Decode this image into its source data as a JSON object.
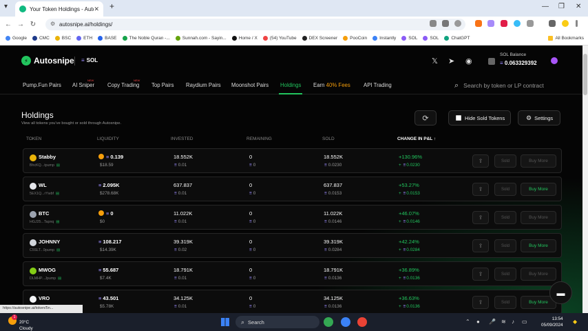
{
  "browser": {
    "tab_title": "Your Token Holdings - Autosnip",
    "url": "autosnipe.ai/holdings/",
    "bookmarks": [
      "Google",
      "CMC",
      "BSC",
      "ETH",
      "BASE",
      "The Noble Quran -...",
      "Sunnah.com - Sayin...",
      "Home / X",
      "(54) YouTube",
      "DEX Screener",
      "PooCoin",
      "Instantly",
      "SOL",
      "SOL",
      "ChatGPT"
    ],
    "all_bookmarks": "All Bookmarks",
    "status_url": "https://autosnipe.ai/token/5n..."
  },
  "header": {
    "logo": "Autosnipe",
    "chain": "SOL",
    "balance_label": "SOL Balance",
    "balance_value": "0.063329392"
  },
  "nav": {
    "items": [
      "Pump.Fun Pairs",
      "AI Sniper",
      "Copy Trading",
      "Top Pairs",
      "Raydium Pairs",
      "Moonshot Pairs",
      "Holdings",
      "Earn",
      "API Trading"
    ],
    "earn_highlight": "40% Fees",
    "new_badge": "NEW",
    "search_placeholder": "Search by token or LP contract"
  },
  "page": {
    "title": "Holdings",
    "subtitle": "View all tokens you've bought or sold through Autosnipe.",
    "hide_sold": "Hide Sold Tokens",
    "settings": "Settings"
  },
  "table": {
    "headers": [
      "TOKEN",
      "LIQUIDITY",
      "INVESTED",
      "REMAINING",
      "SOLD",
      "CHANGE IN P&L ↑"
    ],
    "sold_label": "Sold",
    "buy_label": "Buy More",
    "rows": [
      {
        "name": "Stabby",
        "addr": "BhcKQ...tpump",
        "liq": "0.139",
        "liq_usd": "$18.59",
        "invested": "18.552K",
        "invested_sol": "0.01",
        "remaining": "0",
        "remaining_sol": "0",
        "sold": "18.552K",
        "sold_sol": "0.0230",
        "pnl": "+130.96%",
        "pnl_sol": "0.0230",
        "icon_color": "#eab308",
        "buy_enabled": false
      },
      {
        "name": "WL",
        "addr": "5EX1Q...rYwbf",
        "liq": "2.095K",
        "liq_usd": "$278.68K",
        "invested": "637.837",
        "invested_sol": "0.01",
        "remaining": "0",
        "remaining_sol": "0",
        "sold": "637.837",
        "sold_sol": "0.0153",
        "pnl": "+53.27%",
        "pnl_sol": "0.0153",
        "icon_color": "#e5e7eb",
        "buy_enabled": true
      },
      {
        "name": "BTC",
        "addr": "HGJ25...Tapnq",
        "liq": "0",
        "liq_usd": "$0",
        "invested": "11.022K",
        "invested_sol": "0.01",
        "remaining": "0",
        "remaining_sol": "0",
        "sold": "11.022K",
        "sold_sol": "0.0146",
        "pnl": "+46.07%",
        "pnl_sol": "0.0146",
        "icon_color": "#9ca3af",
        "buy_enabled": false
      },
      {
        "name": "JOHNNY",
        "addr": "C5SLT...9pump",
        "liq": "108.217",
        "liq_usd": "$14.39K",
        "invested": "39.319K",
        "invested_sol": "0.02",
        "remaining": "0",
        "remaining_sol": "0",
        "sold": "39.319K",
        "sold_sol": "0.0284",
        "pnl": "+42.24%",
        "pnl_sol": "0.0284",
        "icon_color": "#d1d5db",
        "buy_enabled": true
      },
      {
        "name": "MWOG",
        "addr": "DLMHP...Jpump",
        "liq": "55.687",
        "liq_usd": "$7.4K",
        "invested": "18.791K",
        "invested_sol": "0.01",
        "remaining": "0",
        "remaining_sol": "0",
        "sold": "18.791K",
        "sold_sol": "0.0136",
        "pnl": "+36.89%",
        "pnl_sol": "0.0136",
        "icon_color": "#84cc16",
        "buy_enabled": false
      },
      {
        "name": "VRO",
        "addr": "9wHxa...tpump",
        "liq": "43.501",
        "liq_usd": "$5.78K",
        "invested": "34.125K",
        "invested_sol": "0.01",
        "remaining": "0",
        "remaining_sol": "0",
        "sold": "34.125K",
        "sold_sol": "0.0136",
        "pnl": "+36.63%",
        "pnl_sol": "0.0136",
        "icon_color": "#f3f4f6",
        "buy_enabled": true
      }
    ]
  },
  "taskbar": {
    "temp": "20°C",
    "weather": "Cloudy",
    "search": "Search",
    "time": "13:54",
    "date": "05/09/2024",
    "notif_count": "1"
  },
  "colors": {
    "accent": "#22c55e",
    "sol": "#9b8cff",
    "bg": "#050505"
  }
}
